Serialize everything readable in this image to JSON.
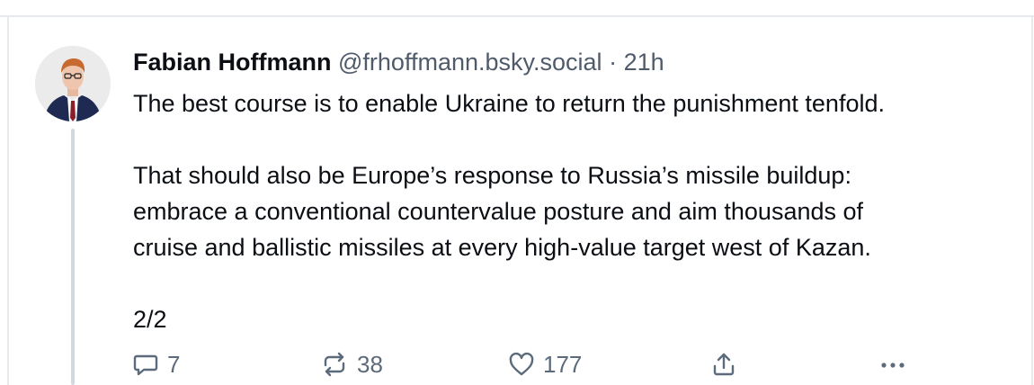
{
  "post": {
    "author_name": "Fabian Hoffmann",
    "author_handle": "@frhoffmann.bsky.social",
    "separator": "·",
    "timestamp": "21h",
    "paragraphs": [
      [
        "The best course is to enable Ukraine to return the punishment tenfold."
      ],
      [
        "That should also be Europe’s response to Russia’s missile buildup:",
        "embrace a conventional countervalue posture and aim thousands of",
        "cruise and ballistic missiles at every high-value target west of Kazan."
      ],
      [
        "2/2"
      ]
    ]
  },
  "actions": {
    "reply_count": "7",
    "repost_count": "38",
    "like_count": "177"
  },
  "icons": {
    "reply": "reply-icon",
    "repost": "repost-icon",
    "like": "heart-icon",
    "share": "share-icon",
    "more": "more-icon"
  },
  "colors": {
    "text": "#0b0f14",
    "muted": "#4f5b6b",
    "action": "#5c6b7c",
    "thread_line": "#d3d8df",
    "border": "#e6e9ee"
  }
}
